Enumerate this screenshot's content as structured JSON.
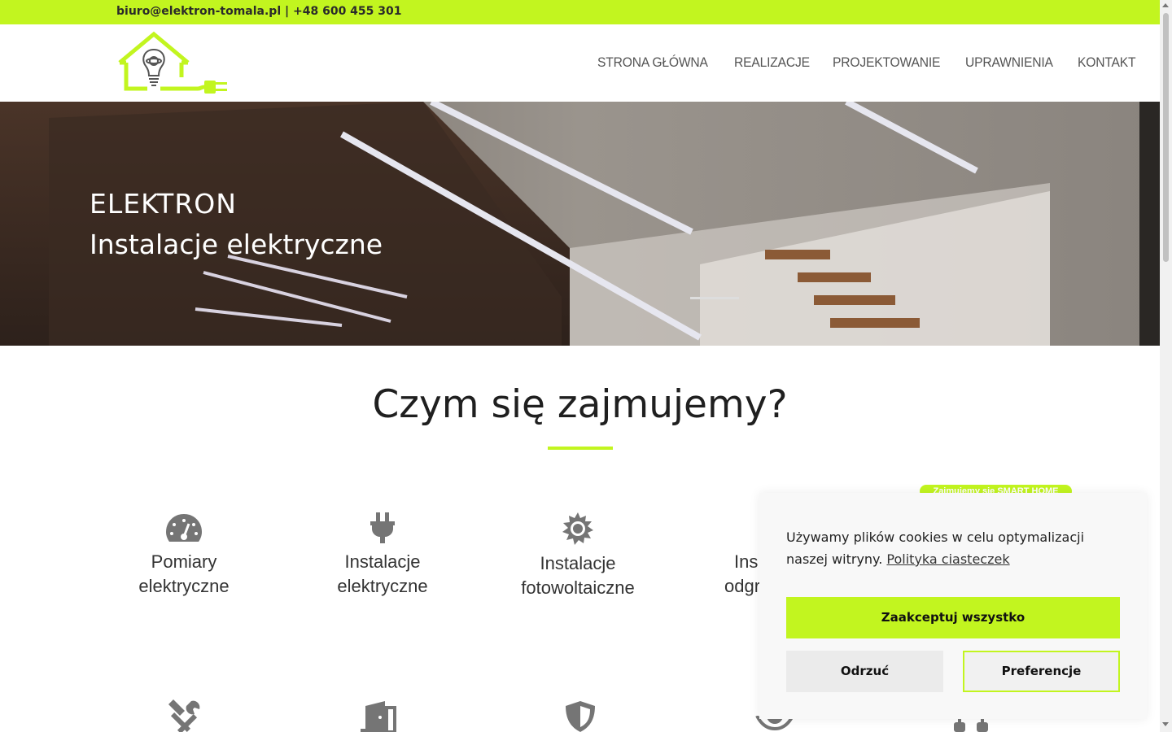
{
  "topbar": {
    "contact": "biuro@elektron-tomala.pl | +48 600 455 301"
  },
  "nav": {
    "items": [
      {
        "label": "STRONA GŁÓWNA"
      },
      {
        "label": "REALIZACJE"
      },
      {
        "label": "PROJEKTOWANIE"
      },
      {
        "label": "UPRAWNIENIA"
      },
      {
        "label": "KONTAKT"
      }
    ]
  },
  "hero": {
    "title": "ELEKTRON",
    "subtitle": "Instalacje elektryczne"
  },
  "services": {
    "heading": "Czym się zajmujemy?",
    "items": [
      {
        "line1": "Pomiary",
        "line2": "elektryczne",
        "icon": "gauge-icon"
      },
      {
        "line1": "Instalacje",
        "line2": "elektryczne",
        "icon": "plug-icon"
      },
      {
        "line1": "Instalacje",
        "line2": "fotowoltaiczne",
        "icon": "sun-icon"
      },
      {
        "line1": "Ins",
        "line2": "odgr",
        "icon": "lightning-icon"
      }
    ],
    "second_row_icons": [
      "tools-icon",
      "door-icon",
      "shield-icon",
      "eye-icon",
      "building-icon"
    ],
    "smart_badge": "Zajmujemy się SMART HOME"
  },
  "cookie": {
    "text": "Używamy plików cookies w celu optymalizacji naszej witryny.",
    "link": "Polityka ciasteczek",
    "accept": "Zaakceptuj wszystko",
    "reject": "Odrzuć",
    "preferences": "Preferencje"
  },
  "colors": {
    "accent": "#c2f51f",
    "text": "#222222",
    "nav": "#555555",
    "icon": "#757575"
  }
}
